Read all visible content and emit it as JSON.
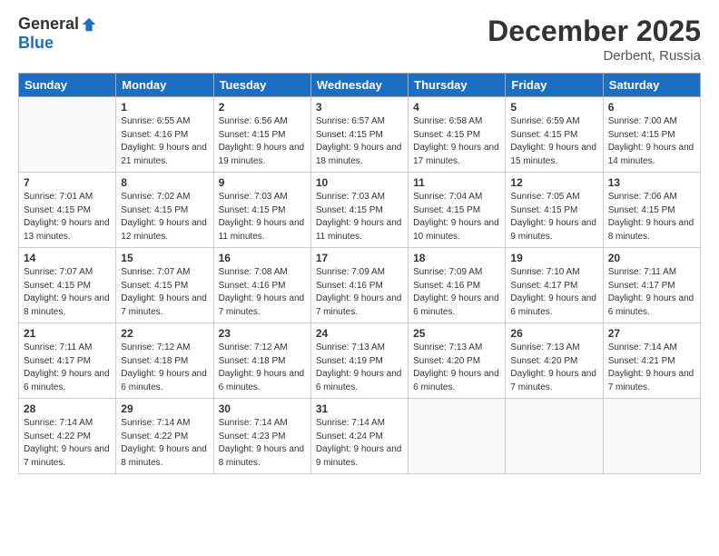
{
  "logo": {
    "general": "General",
    "blue": "Blue"
  },
  "header": {
    "month": "December 2025",
    "location": "Derbent, Russia"
  },
  "weekdays": [
    "Sunday",
    "Monday",
    "Tuesday",
    "Wednesday",
    "Thursday",
    "Friday",
    "Saturday"
  ],
  "weeks": [
    [
      {
        "day": "",
        "sunrise": "",
        "sunset": "",
        "daylight": ""
      },
      {
        "day": "1",
        "sunrise": "Sunrise: 6:55 AM",
        "sunset": "Sunset: 4:16 PM",
        "daylight": "Daylight: 9 hours and 21 minutes."
      },
      {
        "day": "2",
        "sunrise": "Sunrise: 6:56 AM",
        "sunset": "Sunset: 4:15 PM",
        "daylight": "Daylight: 9 hours and 19 minutes."
      },
      {
        "day": "3",
        "sunrise": "Sunrise: 6:57 AM",
        "sunset": "Sunset: 4:15 PM",
        "daylight": "Daylight: 9 hours and 18 minutes."
      },
      {
        "day": "4",
        "sunrise": "Sunrise: 6:58 AM",
        "sunset": "Sunset: 4:15 PM",
        "daylight": "Daylight: 9 hours and 17 minutes."
      },
      {
        "day": "5",
        "sunrise": "Sunrise: 6:59 AM",
        "sunset": "Sunset: 4:15 PM",
        "daylight": "Daylight: 9 hours and 15 minutes."
      },
      {
        "day": "6",
        "sunrise": "Sunrise: 7:00 AM",
        "sunset": "Sunset: 4:15 PM",
        "daylight": "Daylight: 9 hours and 14 minutes."
      }
    ],
    [
      {
        "day": "7",
        "sunrise": "Sunrise: 7:01 AM",
        "sunset": "Sunset: 4:15 PM",
        "daylight": "Daylight: 9 hours and 13 minutes."
      },
      {
        "day": "8",
        "sunrise": "Sunrise: 7:02 AM",
        "sunset": "Sunset: 4:15 PM",
        "daylight": "Daylight: 9 hours and 12 minutes."
      },
      {
        "day": "9",
        "sunrise": "Sunrise: 7:03 AM",
        "sunset": "Sunset: 4:15 PM",
        "daylight": "Daylight: 9 hours and 11 minutes."
      },
      {
        "day": "10",
        "sunrise": "Sunrise: 7:03 AM",
        "sunset": "Sunset: 4:15 PM",
        "daylight": "Daylight: 9 hours and 11 minutes."
      },
      {
        "day": "11",
        "sunrise": "Sunrise: 7:04 AM",
        "sunset": "Sunset: 4:15 PM",
        "daylight": "Daylight: 9 hours and 10 minutes."
      },
      {
        "day": "12",
        "sunrise": "Sunrise: 7:05 AM",
        "sunset": "Sunset: 4:15 PM",
        "daylight": "Daylight: 9 hours and 9 minutes."
      },
      {
        "day": "13",
        "sunrise": "Sunrise: 7:06 AM",
        "sunset": "Sunset: 4:15 PM",
        "daylight": "Daylight: 9 hours and 8 minutes."
      }
    ],
    [
      {
        "day": "14",
        "sunrise": "Sunrise: 7:07 AM",
        "sunset": "Sunset: 4:15 PM",
        "daylight": "Daylight: 9 hours and 8 minutes."
      },
      {
        "day": "15",
        "sunrise": "Sunrise: 7:07 AM",
        "sunset": "Sunset: 4:15 PM",
        "daylight": "Daylight: 9 hours and 7 minutes."
      },
      {
        "day": "16",
        "sunrise": "Sunrise: 7:08 AM",
        "sunset": "Sunset: 4:16 PM",
        "daylight": "Daylight: 9 hours and 7 minutes."
      },
      {
        "day": "17",
        "sunrise": "Sunrise: 7:09 AM",
        "sunset": "Sunset: 4:16 PM",
        "daylight": "Daylight: 9 hours and 7 minutes."
      },
      {
        "day": "18",
        "sunrise": "Sunrise: 7:09 AM",
        "sunset": "Sunset: 4:16 PM",
        "daylight": "Daylight: 9 hours and 6 minutes."
      },
      {
        "day": "19",
        "sunrise": "Sunrise: 7:10 AM",
        "sunset": "Sunset: 4:17 PM",
        "daylight": "Daylight: 9 hours and 6 minutes."
      },
      {
        "day": "20",
        "sunrise": "Sunrise: 7:11 AM",
        "sunset": "Sunset: 4:17 PM",
        "daylight": "Daylight: 9 hours and 6 minutes."
      }
    ],
    [
      {
        "day": "21",
        "sunrise": "Sunrise: 7:11 AM",
        "sunset": "Sunset: 4:17 PM",
        "daylight": "Daylight: 9 hours and 6 minutes."
      },
      {
        "day": "22",
        "sunrise": "Sunrise: 7:12 AM",
        "sunset": "Sunset: 4:18 PM",
        "daylight": "Daylight: 9 hours and 6 minutes."
      },
      {
        "day": "23",
        "sunrise": "Sunrise: 7:12 AM",
        "sunset": "Sunset: 4:18 PM",
        "daylight": "Daylight: 9 hours and 6 minutes."
      },
      {
        "day": "24",
        "sunrise": "Sunrise: 7:13 AM",
        "sunset": "Sunset: 4:19 PM",
        "daylight": "Daylight: 9 hours and 6 minutes."
      },
      {
        "day": "25",
        "sunrise": "Sunrise: 7:13 AM",
        "sunset": "Sunset: 4:20 PM",
        "daylight": "Daylight: 9 hours and 6 minutes."
      },
      {
        "day": "26",
        "sunrise": "Sunrise: 7:13 AM",
        "sunset": "Sunset: 4:20 PM",
        "daylight": "Daylight: 9 hours and 7 minutes."
      },
      {
        "day": "27",
        "sunrise": "Sunrise: 7:14 AM",
        "sunset": "Sunset: 4:21 PM",
        "daylight": "Daylight: 9 hours and 7 minutes."
      }
    ],
    [
      {
        "day": "28",
        "sunrise": "Sunrise: 7:14 AM",
        "sunset": "Sunset: 4:22 PM",
        "daylight": "Daylight: 9 hours and 7 minutes."
      },
      {
        "day": "29",
        "sunrise": "Sunrise: 7:14 AM",
        "sunset": "Sunset: 4:22 PM",
        "daylight": "Daylight: 9 hours and 8 minutes."
      },
      {
        "day": "30",
        "sunrise": "Sunrise: 7:14 AM",
        "sunset": "Sunset: 4:23 PM",
        "daylight": "Daylight: 9 hours and 8 minutes."
      },
      {
        "day": "31",
        "sunrise": "Sunrise: 7:14 AM",
        "sunset": "Sunset: 4:24 PM",
        "daylight": "Daylight: 9 hours and 9 minutes."
      },
      {
        "day": "",
        "sunrise": "",
        "sunset": "",
        "daylight": ""
      },
      {
        "day": "",
        "sunrise": "",
        "sunset": "",
        "daylight": ""
      },
      {
        "day": "",
        "sunrise": "",
        "sunset": "",
        "daylight": ""
      }
    ]
  ]
}
